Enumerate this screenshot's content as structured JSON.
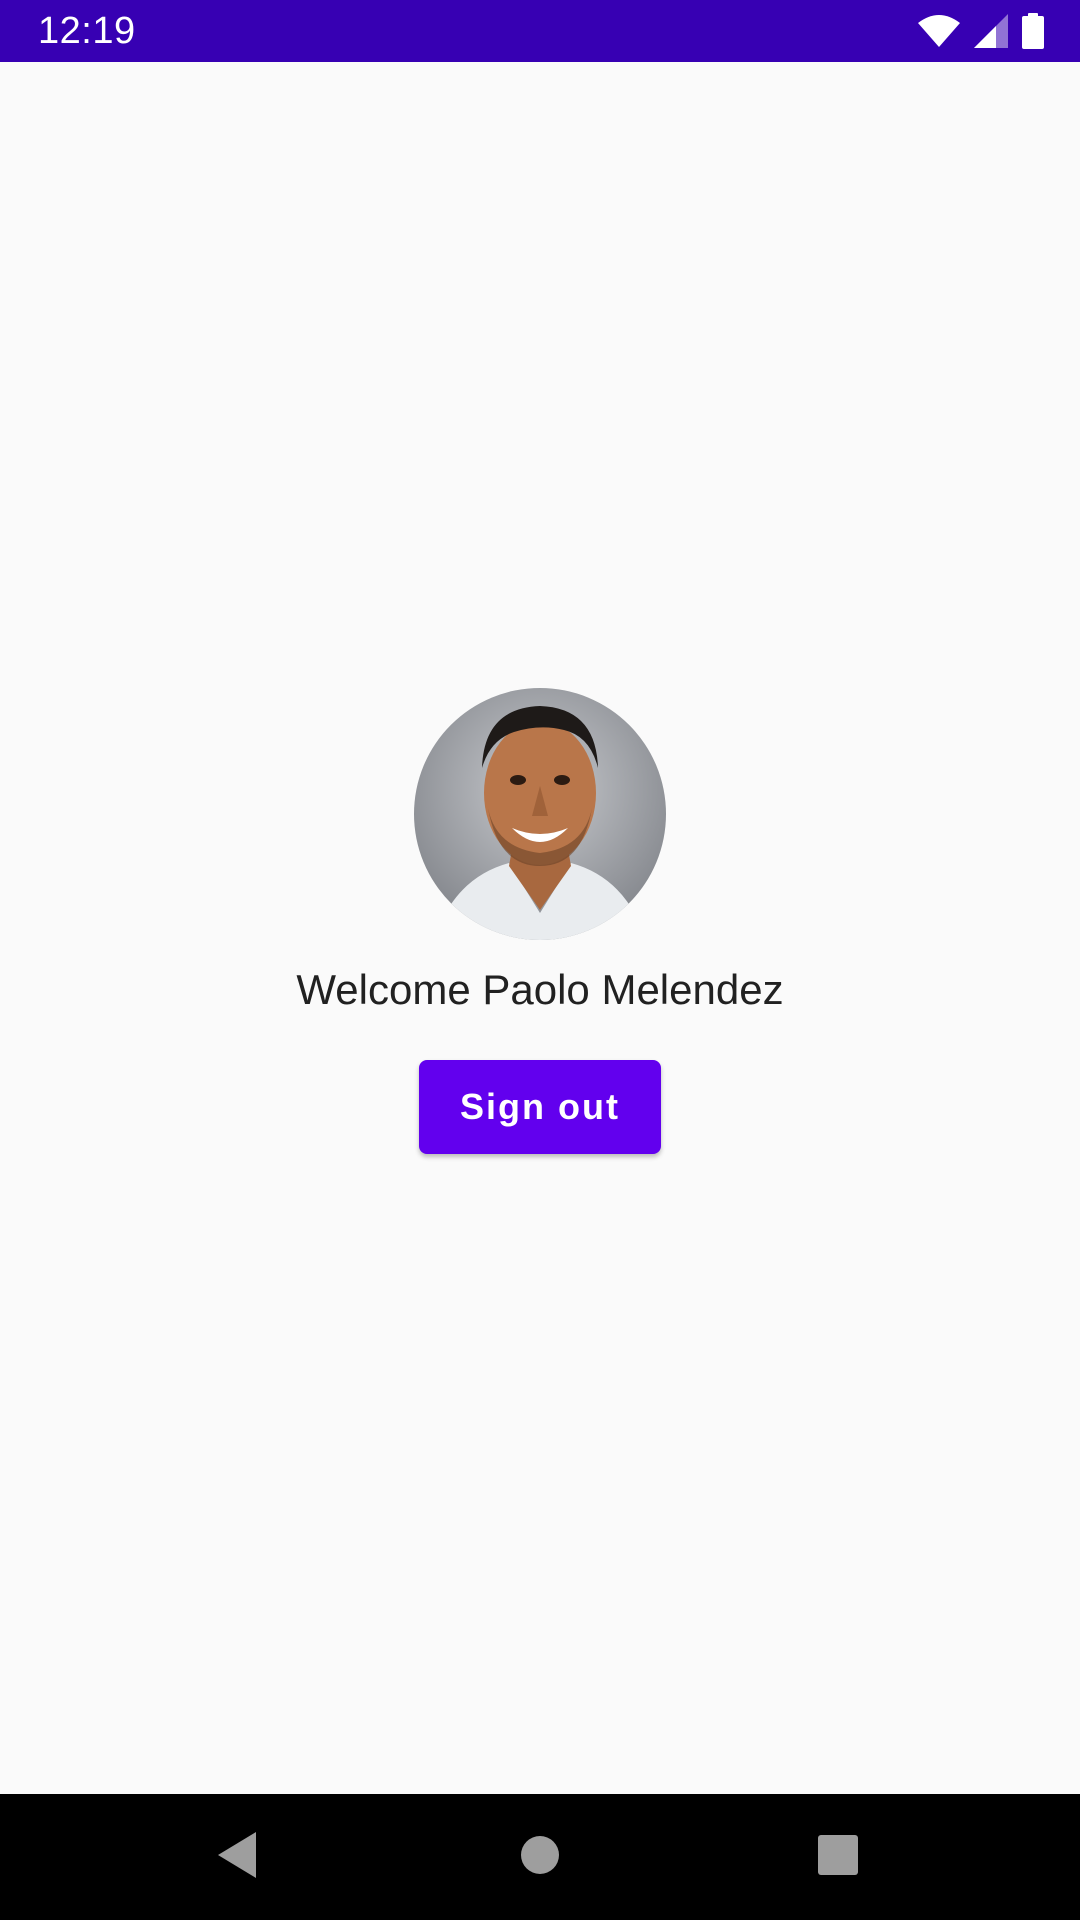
{
  "status_bar": {
    "time": "12:19",
    "icons": [
      "wifi-icon",
      "cell-signal-icon",
      "battery-icon"
    ],
    "background": "#3700b3"
  },
  "profile": {
    "avatar_icon": "user-photo",
    "welcome_text": "Welcome Paolo Melendez"
  },
  "actions": {
    "sign_out_label": "Sign out",
    "accent": "#6200ee"
  },
  "nav_bar": {
    "icons": [
      "back-icon",
      "home-icon",
      "recents-icon"
    ]
  }
}
